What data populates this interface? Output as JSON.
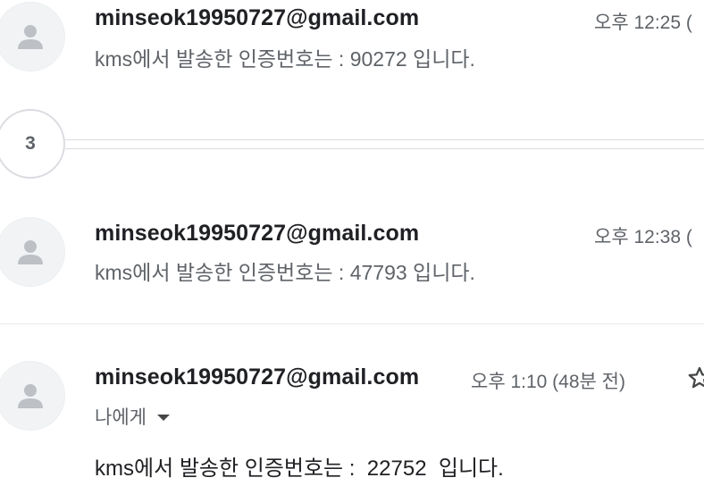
{
  "messages": [
    {
      "sender": "minseok19950727@gmail.com",
      "time": "오후 12:25 (",
      "snippet": "kms에서 발송한 인증번호는 : 90272 입니다."
    },
    {
      "sender": "minseok19950727@gmail.com",
      "time": "오후 12:38 (",
      "snippet": "kms에서 발송한 인증번호는 : 47793 입니다."
    }
  ],
  "collapsed": {
    "count": "3"
  },
  "expanded": {
    "sender": "minseok19950727@gmail.com",
    "time": "오후 1:10 (48분 전)",
    "recipient": "나에게",
    "body": "kms에서 발송한 인증번호는 :  22752  입니다."
  },
  "icons": {
    "avatar": "person-icon",
    "recipient_toggle": "caret-down-icon",
    "star": "star-icon"
  },
  "colors": {
    "sender": "#202124",
    "muted": "#5f6368",
    "avatar_bg": "#f1f3f4",
    "avatar_glyph": "#bdc1c6"
  }
}
